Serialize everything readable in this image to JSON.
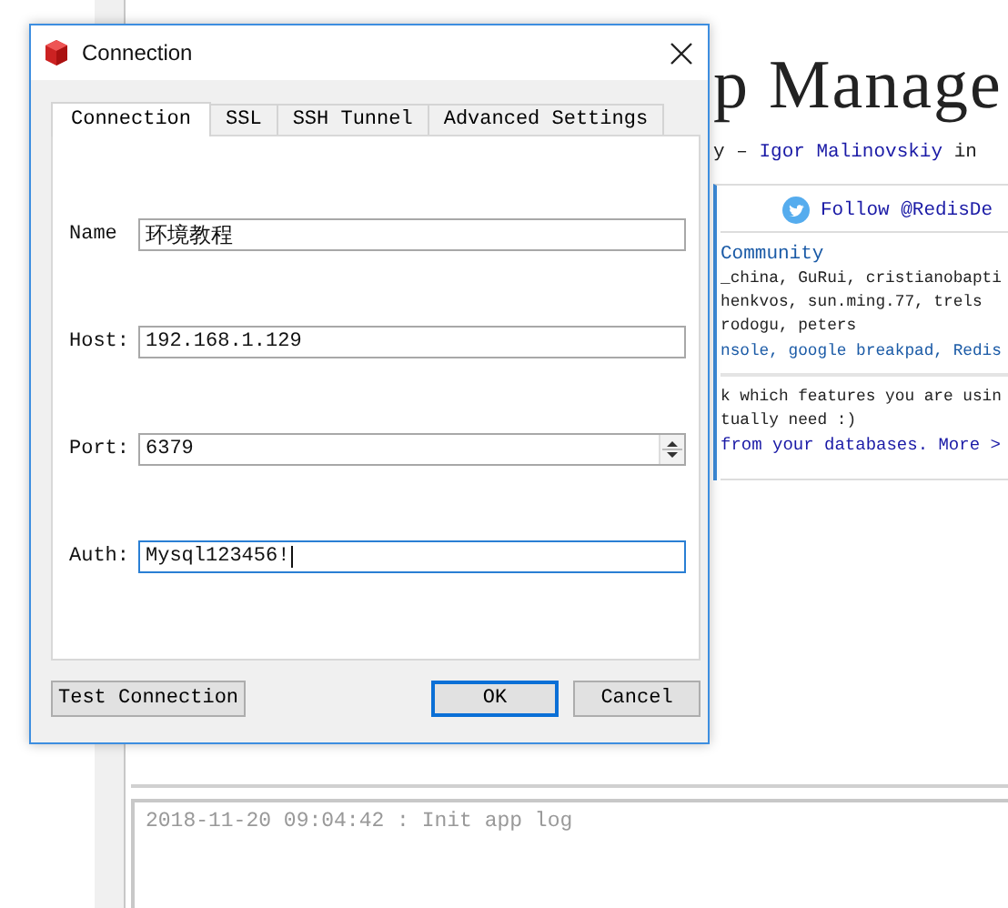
{
  "background": {
    "title": "p Manage",
    "byline": {
      "prefix": "y – ",
      "author": "Igor Malinovskiy",
      "suffix": " in"
    },
    "follow": "Follow @RedisDe",
    "community": {
      "heading": "Community",
      "lines": [
        "_china, GuRui, cristianobapti",
        "henkvos, sun.ming.77, trels",
        "rodogu, peters"
      ],
      "projects": "nsole, google breakpad, Redis"
    },
    "feature_lines": [
      "k which features you are usin",
      "tually need :)"
    ],
    "feature_link": "from your databases. More >",
    "log": [
      "2018-11-20 09:04:42 : Init app log"
    ]
  },
  "dialog": {
    "title": "Connection",
    "tabs": [
      {
        "label": "Connection",
        "selected": true
      },
      {
        "label": "SSL",
        "selected": false
      },
      {
        "label": "SSH Tunnel",
        "selected": false
      },
      {
        "label": "Advanced Settings",
        "selected": false
      }
    ],
    "fields": [
      {
        "label": "Name",
        "value": "环境教程",
        "kind": "text",
        "focused": false
      },
      {
        "label": "Host:",
        "value": "192.168.1.129",
        "kind": "text",
        "focused": false
      },
      {
        "label": "Port:",
        "value": "6379",
        "kind": "spin",
        "focused": false
      },
      {
        "label": "Auth:",
        "value": "Mysql123456!",
        "kind": "text",
        "focused": true
      }
    ],
    "buttons": [
      {
        "label": "Test Connection",
        "default": false,
        "kind": "left"
      },
      {
        "label": "OK",
        "default": true,
        "kind": "right"
      },
      {
        "label": "Cancel",
        "default": false,
        "kind": "right"
      }
    ]
  }
}
